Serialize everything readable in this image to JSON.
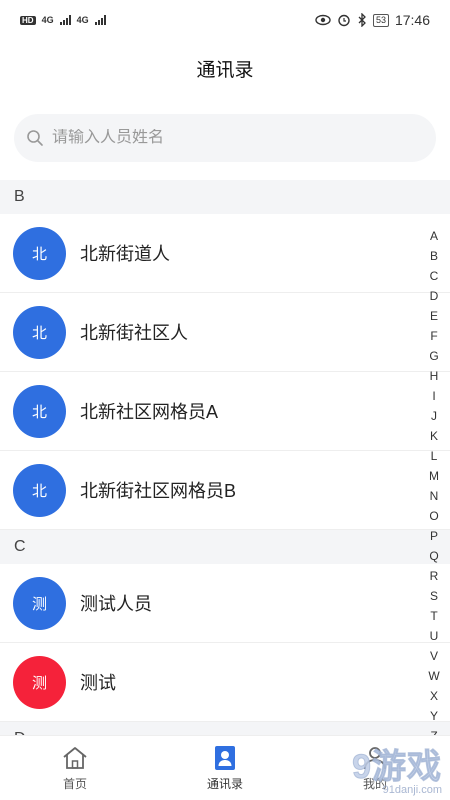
{
  "status_bar": {
    "left_hd": "HD",
    "left_net1": "4G",
    "left_net2": "4G",
    "battery": "53",
    "time": "17:46"
  },
  "header": {
    "title": "通讯录"
  },
  "search": {
    "placeholder": "请输入人员姓名",
    "value": ""
  },
  "sections": [
    {
      "letter": "B",
      "contacts": [
        {
          "avatar_text": "北",
          "name": "北新街道人",
          "color": "#2f6fe0"
        },
        {
          "avatar_text": "北",
          "name": "北新街社区人",
          "color": "#2f6fe0"
        },
        {
          "avatar_text": "北",
          "name": "北新社区网格员A",
          "color": "#2f6fe0"
        },
        {
          "avatar_text": "北",
          "name": "北新街社区网格员B",
          "color": "#2f6fe0"
        }
      ]
    },
    {
      "letter": "C",
      "contacts": [
        {
          "avatar_text": "测",
          "name": "测试人员",
          "color": "#2f6fe0"
        },
        {
          "avatar_text": "测",
          "name": "测试",
          "color": "#f5223a"
        }
      ]
    },
    {
      "letter": "D",
      "contacts": []
    }
  ],
  "index_letters": [
    "A",
    "B",
    "C",
    "D",
    "E",
    "F",
    "G",
    "H",
    "I",
    "J",
    "K",
    "L",
    "M",
    "N",
    "O",
    "P",
    "Q",
    "R",
    "S",
    "T",
    "U",
    "V",
    "W",
    "X",
    "Y",
    "Z"
  ],
  "tabs": [
    {
      "label": "首页",
      "icon": "home-icon",
      "active": false
    },
    {
      "label": "通讯录",
      "icon": "contacts-icon",
      "active": true
    },
    {
      "label": "我的",
      "icon": "profile-icon",
      "active": false
    }
  ],
  "watermark": {
    "big": "9游戏",
    "small": "91danji.com"
  },
  "colors": {
    "accent": "#2f6fe0",
    "red_avatar": "#f5223a",
    "section_bg": "#f4f5f7"
  }
}
